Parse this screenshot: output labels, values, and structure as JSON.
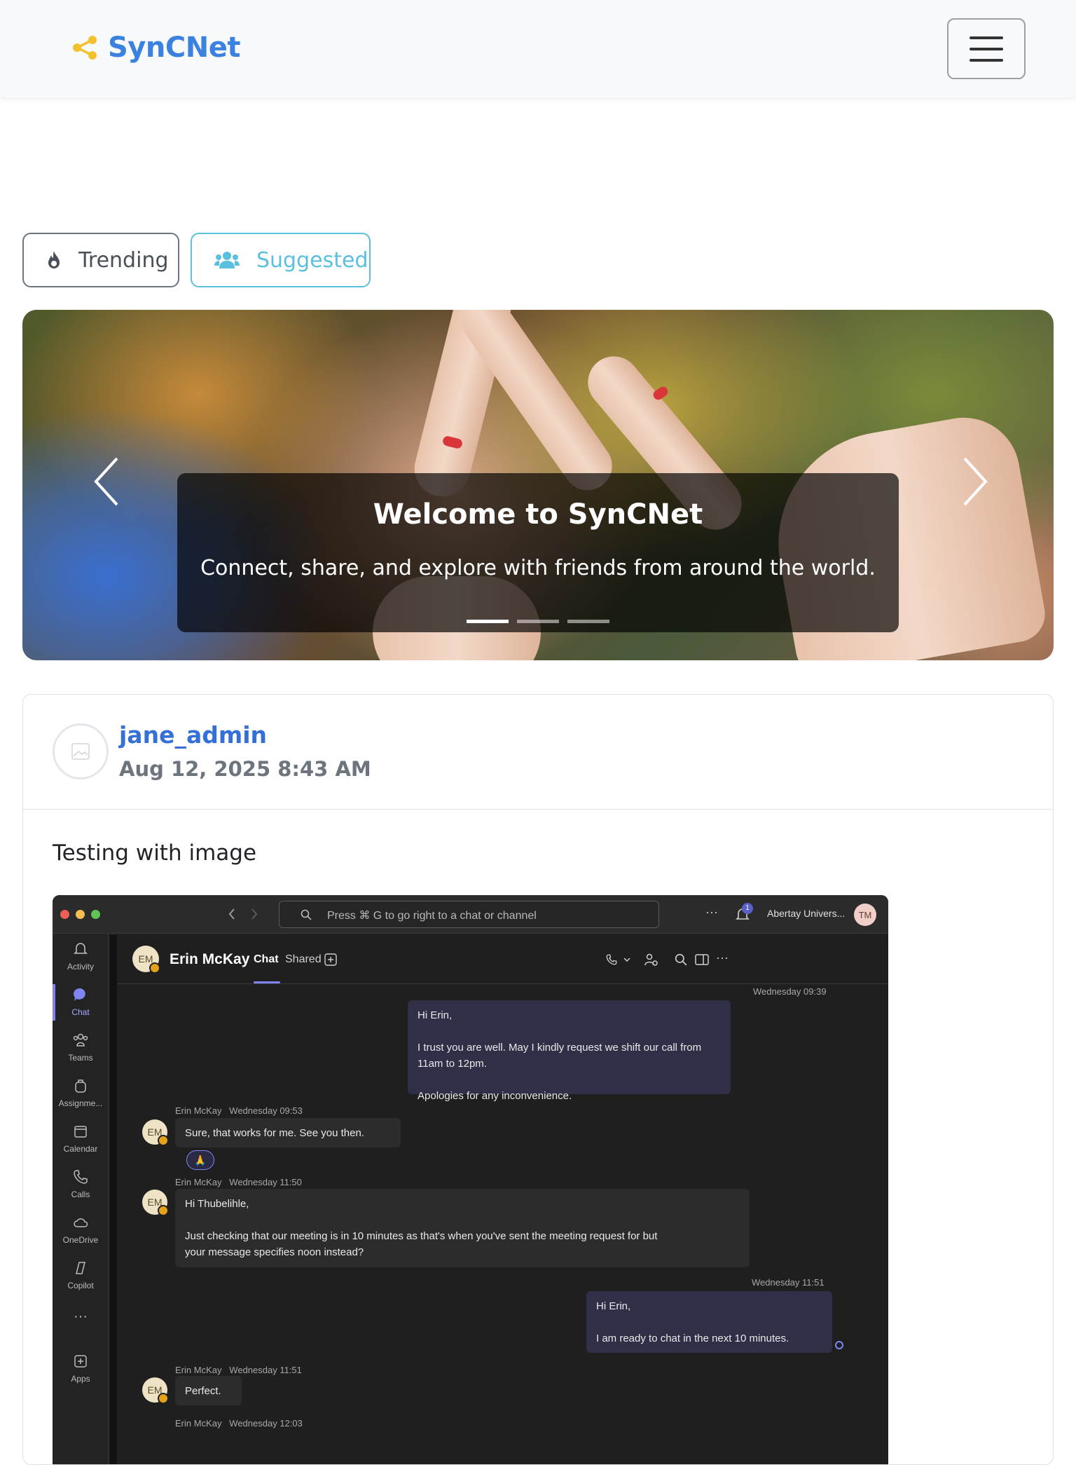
{
  "navbar": {
    "brand": "SynCNet",
    "brand_icon": "share-nodes-icon",
    "menu_icon": "hamburger-icon"
  },
  "filters": {
    "trending_label": "Trending",
    "trending_icon": "fire-icon",
    "suggested_label": "Suggested",
    "suggested_icon": "users-icon"
  },
  "carousel": {
    "title": "Welcome to SynCNet",
    "subtitle": "Connect, share, and explore with friends from around the world.",
    "slide_count": 3,
    "active_slide": 1
  },
  "post": {
    "username": "jane_admin",
    "date": "Aug 12, 2025 8:43 AM",
    "text": "Testing with image",
    "image": {
      "search_placeholder": "Press ⌘ G to go right to a chat or channel",
      "notification_count": "1",
      "org": "Abertay Univers...",
      "user_initials": "TM",
      "rail": [
        "Activity",
        "Chat",
        "Teams",
        "Assignme...",
        "Calendar",
        "Calls",
        "OneDrive",
        "Copilot",
        "Apps"
      ],
      "contact_initials": "EM",
      "contact": "Erin McKay",
      "tabs": [
        "Chat",
        "Shared"
      ],
      "messages": [
        {
          "meta": "Wednesday 09:39",
          "lines": [
            "Hi Erin,",
            "",
            "I trust you are well. May I kindly request we shift our call from 11am to 12pm.",
            "",
            "Apologies for any inconvenience."
          ]
        },
        {
          "meta": "Erin McKay   Wednesday 09:53",
          "lines": [
            "Sure, that works for me. See you then."
          ]
        },
        {
          "meta": "Erin McKay   Wednesday 11:50",
          "lines": [
            "Hi Thubelihle,",
            "",
            "Just checking that our meeting is in 10 minutes as that's when you've sent the meeting request for but",
            "your message specifies noon instead?"
          ]
        },
        {
          "meta": "Wednesday 11:51",
          "lines": [
            "Hi Erin,",
            "",
            "I am ready to chat in the next 10 minutes."
          ]
        },
        {
          "meta": "Erin McKay   Wednesday 11:51",
          "lines": [
            "Perfect."
          ]
        },
        {
          "meta": "Erin McKay   Wednesday 12:03",
          "lines": []
        }
      ],
      "reaction": "🙏"
    }
  },
  "colors": {
    "brand": "#3b82e0",
    "suggested": "#5bc0de",
    "username": "#3570d9",
    "date": "#6c757d"
  }
}
